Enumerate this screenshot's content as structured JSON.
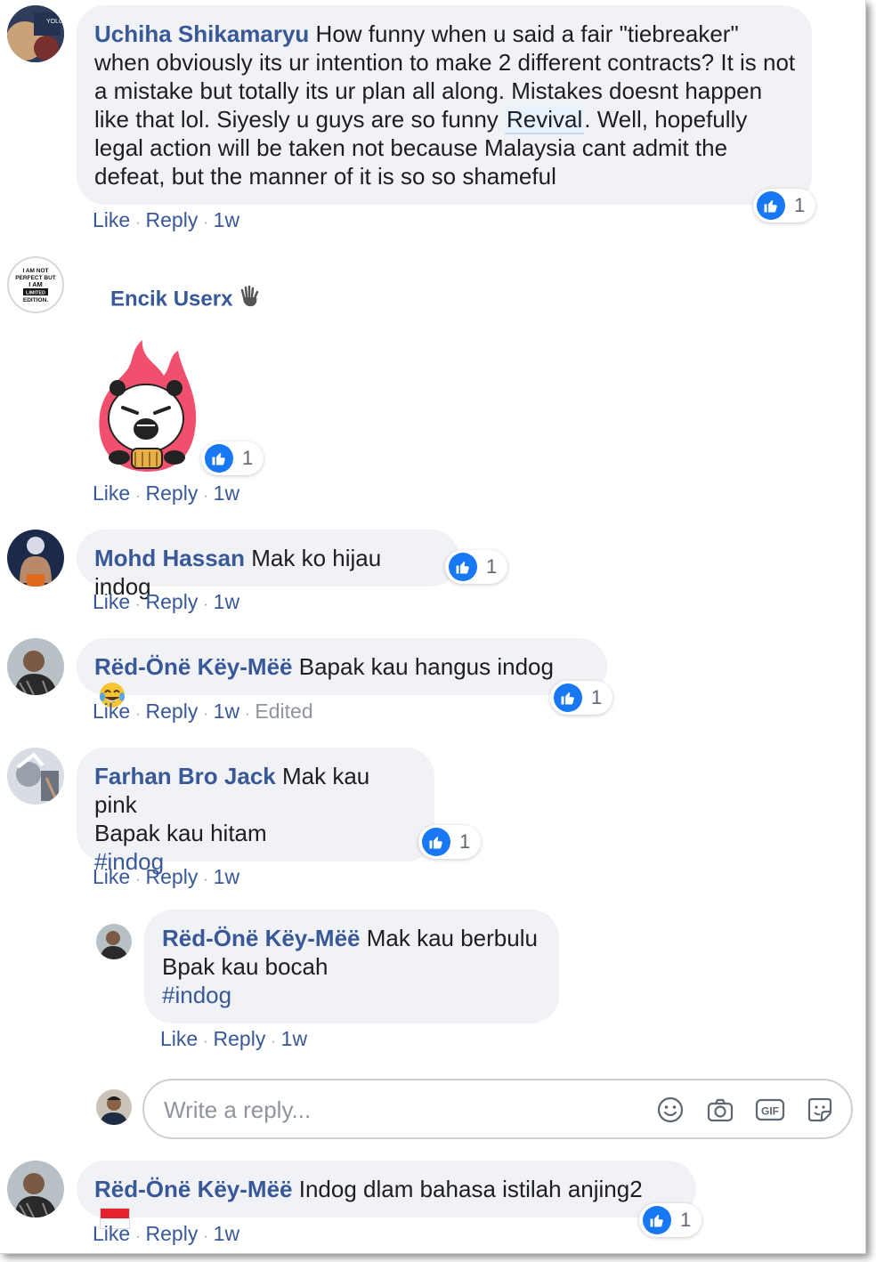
{
  "comments": [
    {
      "author": "Uchiha Shikamaryu",
      "text_before": "How funny when u said a fair \"tiebreaker\" when obviously its ur intention to make 2 different contracts? It is not a mistake but totally its ur plan all along. Mistakes doesnt happen like that lol. Siyesly u guys are so funny",
      "mention": "Revival",
      "text_after": ". Well, hopefully legal action will be taken not because Malaysia cant admit the defeat, but the manner of it is so so shameful",
      "reaction_count": "1",
      "like": "Like",
      "reply": "Reply",
      "time": "1w"
    },
    {
      "author": "Encik Userx",
      "author_emoji": "wave-hand",
      "avatar_text": [
        "I AM NOT",
        "PERFECT BUT",
        "I AM",
        "LIMITED",
        "EDITION."
      ],
      "sticker": "panda-fire-sticker",
      "reaction_count": "1",
      "like": "Like",
      "reply": "Reply",
      "time": "1w"
    },
    {
      "author": "Mohd Hassan",
      "text": "Mak ko hijau indog",
      "reaction_count": "1",
      "like": "Like",
      "reply": "Reply",
      "time": "1w"
    },
    {
      "author": "Rëd-Önë Këy-Mëë",
      "text": "Bapak kau hangus indog",
      "emoji": "laughing-tears",
      "reaction_count": "1",
      "like": "Like",
      "reply": "Reply",
      "time": "1w",
      "edited": "Edited"
    },
    {
      "author": "Farhan Bro Jack",
      "text_line1": "Mak kau pink",
      "text_line2": "Bapak kau hitam",
      "hashtag": "#indog",
      "reaction_count": "1",
      "like": "Like",
      "reply": "Reply",
      "time": "1w"
    },
    {
      "author": "Rëd-Önë Këy-Mëë",
      "text_line1": "Mak kau berbulu",
      "text_line2": "Bpak kau bocah",
      "hashtag": "#indog",
      "like": "Like",
      "reply": "Reply",
      "time": "1w"
    },
    {
      "author": "Rëd-Önë Këy-Mëë",
      "text": "Indog dlam bahasa istilah anjing2",
      "emoji": "indonesia-flag",
      "reaction_count": "1",
      "like": "Like",
      "reply": "Reply",
      "time": "1w"
    }
  ],
  "reply_box": {
    "placeholder": "Write a reply...",
    "icons": [
      "smiley-icon",
      "camera-icon",
      "gif-icon",
      "sticker-icon"
    ]
  },
  "colors": {
    "name": "#385898",
    "bubble": "#f0f2f5",
    "like_blue": "#1877f2"
  }
}
